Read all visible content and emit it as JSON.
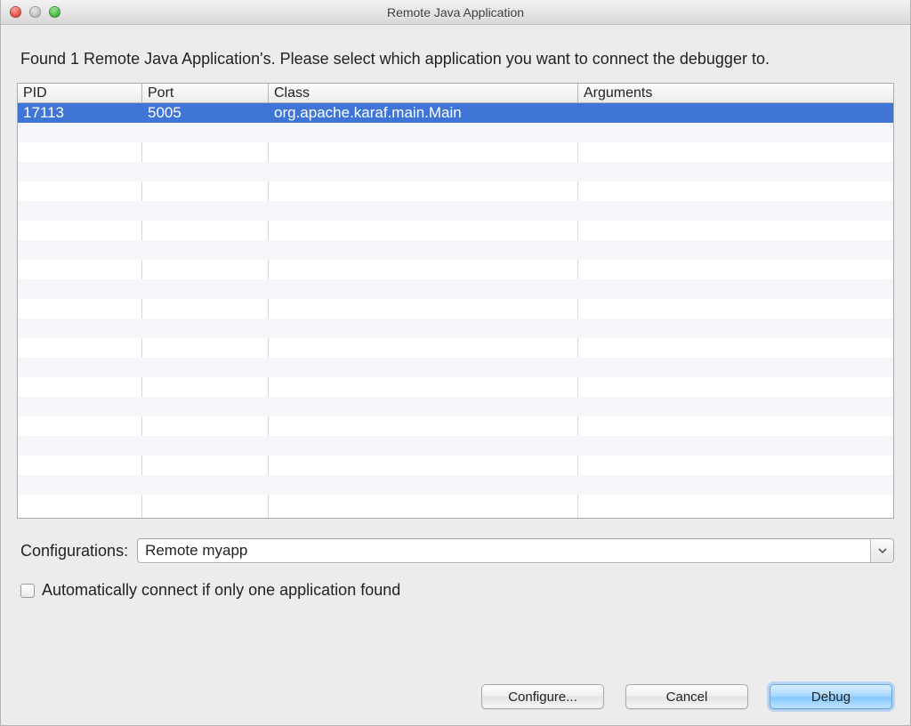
{
  "window": {
    "title": "Remote Java Application"
  },
  "instruction": "Found 1 Remote Java Application's. Please select which application you want to connect the debugger to.",
  "table": {
    "headers": {
      "pid": "PID",
      "port": "Port",
      "class": "Class",
      "args": "Arguments"
    },
    "rows": [
      {
        "pid": "17113",
        "port": "5005",
        "class": "org.apache.karaf.main.Main",
        "args": "",
        "selected": true
      }
    ],
    "empty_row_count": 20
  },
  "configurations": {
    "label": "Configurations:",
    "selected": "Remote myapp"
  },
  "auto_connect": {
    "label": "Automatically connect if only one application found",
    "checked": false
  },
  "buttons": {
    "configure": "Configure...",
    "cancel": "Cancel",
    "debug": "Debug"
  }
}
